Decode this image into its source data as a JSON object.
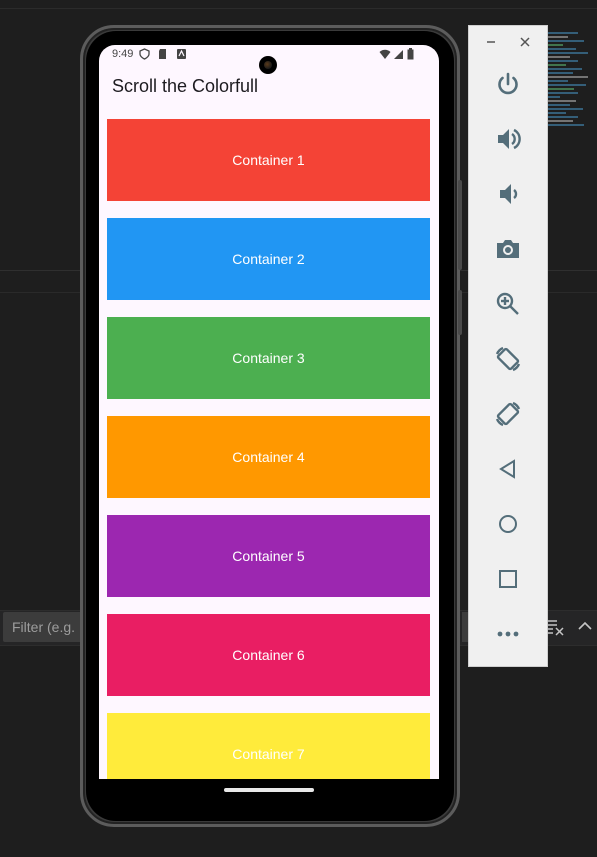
{
  "ide": {
    "filter_placeholder": "Filter (e.g."
  },
  "phone": {
    "status_time": "9:49",
    "app_title": "Scroll the Colorfull",
    "containers": [
      {
        "label": "Container 1",
        "color": "#f44336"
      },
      {
        "label": "Container 2",
        "color": "#2196f3"
      },
      {
        "label": "Container 3",
        "color": "#4caf50"
      },
      {
        "label": "Container 4",
        "color": "#ff9800"
      },
      {
        "label": "Container 5",
        "color": "#9c27b0"
      },
      {
        "label": "Container 6",
        "color": "#e91e63"
      },
      {
        "label": "Container 7",
        "color": "#ffeb3b"
      }
    ]
  },
  "emulator": {
    "accent": "#546e7a",
    "buttons": [
      {
        "name": "power-icon"
      },
      {
        "name": "volume-up-icon"
      },
      {
        "name": "volume-down-icon"
      },
      {
        "name": "camera-icon"
      },
      {
        "name": "zoom-icon"
      },
      {
        "name": "rotate-left-icon"
      },
      {
        "name": "rotate-right-icon"
      },
      {
        "name": "back-icon"
      },
      {
        "name": "home-icon"
      },
      {
        "name": "overview-icon"
      },
      {
        "name": "more-icon"
      }
    ]
  }
}
